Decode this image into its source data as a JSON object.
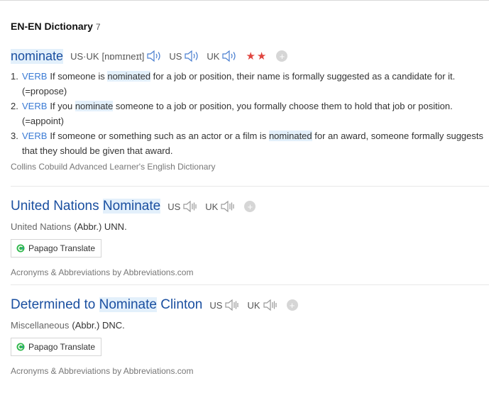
{
  "section": {
    "title": "EN-EN Dictionary",
    "count": "7"
  },
  "entry1": {
    "headword": "nominate",
    "pron_label": "US·UK",
    "pron": "[nɒmɪneɪt]",
    "us_label": "US",
    "uk_label": "UK",
    "stars": "★★",
    "definitions": [
      {
        "num": "1.",
        "pos": "VERB",
        "pre": "If someone is ",
        "hl": "nominated",
        "post": " for a job or position, their name is formally suggested as a candidate for it. (=propose)"
      },
      {
        "num": "2.",
        "pos": "VERB",
        "pre": "If you ",
        "hl": "nominate",
        "post": " someone to a job or position, you formally choose them to hold that job or position. (=appoint)"
      },
      {
        "num": "3.",
        "pos": "VERB",
        "pre": "If someone or something such as an actor or a film is ",
        "hl": "nominated",
        "post": " for an award, someone formally suggests that they should be given that award."
      }
    ],
    "source": "Collins Cobuild Advanced Learner's English Dictionary"
  },
  "entry2": {
    "title_pre": "United Nations ",
    "title_hl": "Nominate",
    "us_label": "US",
    "uk_label": "UK",
    "category": "United Nations",
    "abbr": "(Abbr.) UNN.",
    "translate_label": "Papago Translate",
    "source": "Acronyms & Abbreviations by Abbreviations.com"
  },
  "entry3": {
    "title_pre": "Determined to ",
    "title_hl": "Nominate",
    "title_post": " Clinton",
    "us_label": "US",
    "uk_label": "UK",
    "category": "Miscellaneous",
    "abbr": "(Abbr.) DNC.",
    "translate_label": "Papago Translate",
    "source": "Acronyms & Abbreviations by Abbreviations.com"
  },
  "colors": {
    "headword": "#1a4fa0",
    "pos": "#3a7bd5",
    "stars": "#e0453f",
    "highlight": "#e3f0fb"
  }
}
